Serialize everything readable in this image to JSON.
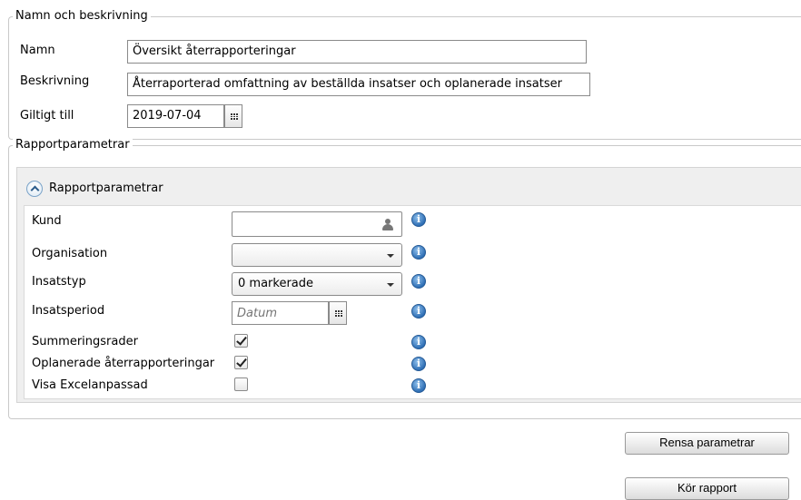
{
  "details": {
    "legend": "Namn och beskrivning",
    "name_label": "Namn",
    "name_value": "Översikt återrapporteringar",
    "description_label": "Beskrivning",
    "description_value": "Återraporterad omfattning av beställda insatser och oplanerade insatser",
    "valid_until_label": "Giltigt till",
    "valid_until_value": "2019-07-04"
  },
  "params": {
    "legend": "Rapportparametrar",
    "panel_title": "Rapportparametrar",
    "customer_label": "Kund",
    "customer_value": "",
    "organisation_label": "Organisation",
    "organisation_value": "",
    "service_type_label": "Insatstyp",
    "service_type_value": "0 markerade",
    "service_period_label": "Insatsperiod",
    "service_period_placeholder": "Datum",
    "summary_rows_label": "Summeringsrader",
    "summary_rows_checked": true,
    "unplanned_label": "Oplanerade återrapporteringar",
    "unplanned_checked": true,
    "excel_label": "Visa Excelanpassad",
    "excel_checked": false
  },
  "actions": {
    "clear_label": "Rensa parametrar",
    "run_label": "Kör rapport"
  },
  "icons": {
    "info": "i"
  }
}
